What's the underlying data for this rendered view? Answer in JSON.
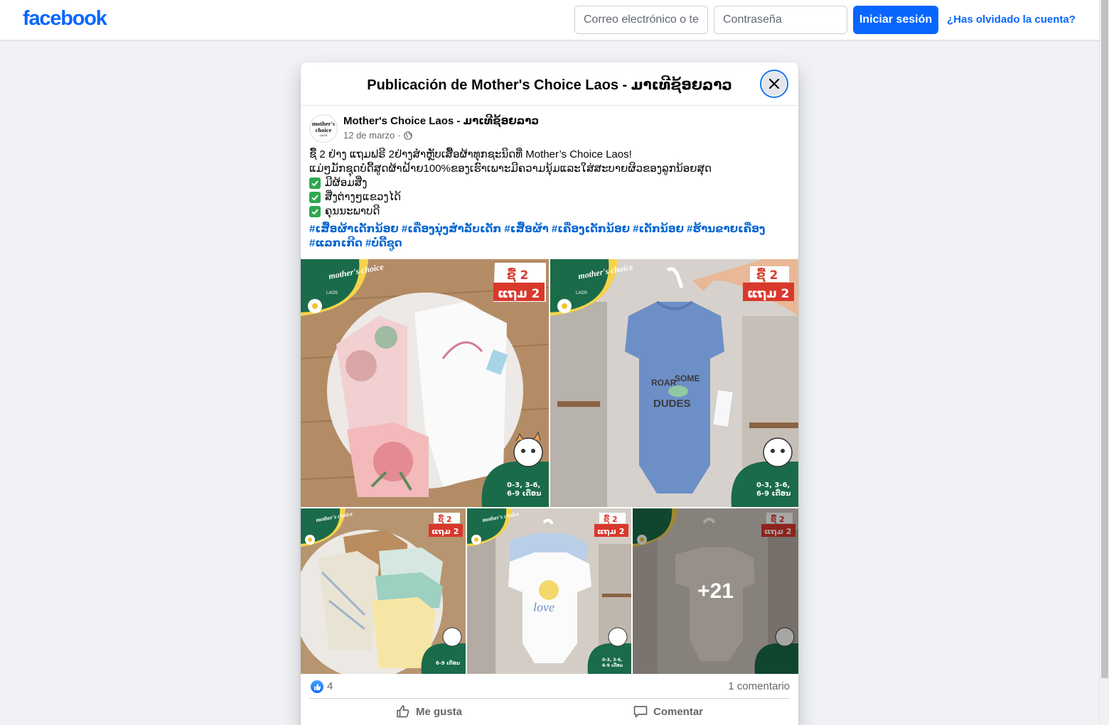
{
  "header": {
    "logo": "facebook",
    "email_placeholder": "Correo electrónico o teléfono",
    "password_placeholder": "Contraseña",
    "login_label": "Iniciar sesión",
    "forgot_label": "¿Has olvidado la cuenta?"
  },
  "modal": {
    "title": "Publicación de Mother's Choice Laos - ມາເທີຊ້ອຍລາວ",
    "author": "Mother's Choice Laos - ມາເທີຊ້ອຍລາວ",
    "avatar_text_1": "mother's",
    "avatar_text_2": "choice",
    "avatar_text_3": "LAOS",
    "date": "12 de marzo",
    "date_sep": "·",
    "text_lines": [
      "ຊື້ 2 ຢ່າງ ແຖມຟຣີ 2ຢ່າງສຳຫຼັບເສື້ອຜ້າທຸກຊະນິດທີ່ Mother’s Choice Laos!",
      "ແມ່ໆມັກຊຸດບໍດີ້ສູດຜ້າຝ້າຍ100%ຂອງເຮົາເພາະມີຄວາມນຸ້ມແລະໃສ່ສະບາຍຜິວຂອງລູກນ້ອຍສຸດ"
    ],
    "check_items": [
      "ມີຜ້ອມສີ່ງ",
      "ສີ່ງຕ່າງໆແຂວງໄດ້",
      "ຄຸນນະພາບດີ"
    ],
    "hashtags": "#ເສື້ອຜ້າເດັກນ້ອຍ #ເຄື່ອງນຸ່ງສຳລັບເດັກ #ເສື້ອຜ້າ #ເຄື່ອງເດັກນ້ອຍ #ເດັກນ້ອຍ #ຮ້ານຂາຍເຄື່ອງ #ແລກເກີດ #ບໍດີ້ຊູດ",
    "photo_badge_top": "ຊື້ 2",
    "photo_badge_bottom": "ແຖມ 2",
    "photo_brand": "mother's choice",
    "photo_brand_sub": "LAOS",
    "photo_sizes": [
      "0-3, 3-6,",
      "6-9 ເດືອນ"
    ],
    "photo_sizes_single": "6-9 ເດືອນ",
    "photo_text_p2": [
      "ROAR",
      "SOME",
      "DUDES"
    ],
    "photo_text_p4": [
      "love"
    ],
    "more_photos": "+21",
    "like_count": "4",
    "comment_count": "1 comentario",
    "like_action": "Me gusta",
    "comment_action": "Comentar"
  },
  "colors": {
    "brand_blue": "#0866ff",
    "link_blue": "#0064d1",
    "brand_green": "#1a6b4a",
    "badge_red": "#d9382c"
  }
}
